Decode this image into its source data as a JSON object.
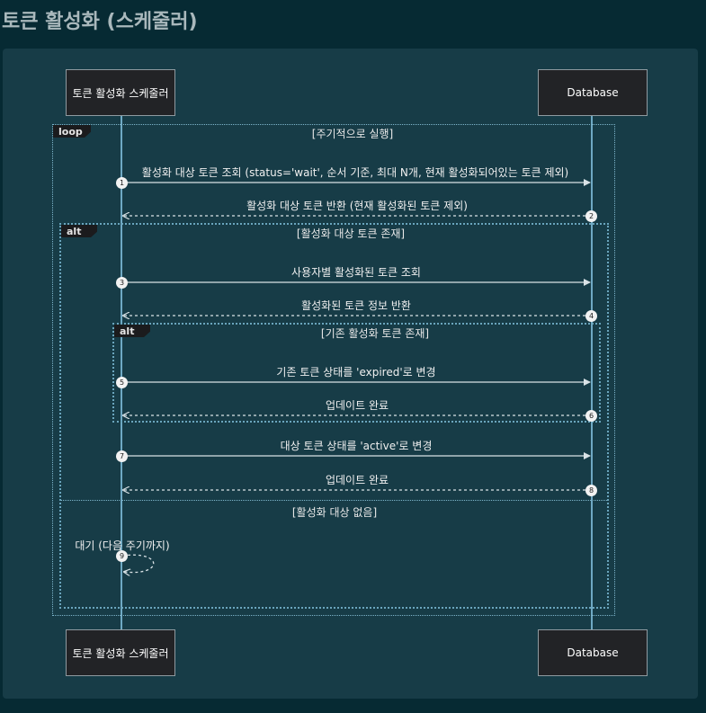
{
  "page": {
    "title": "토큰 활성화 (스케줄러)"
  },
  "actors": {
    "scheduler": "토큰 활성화 스케줄러",
    "database": "Database"
  },
  "frames": {
    "loop": {
      "tag": "loop",
      "condition": "[주기적으로 실행]"
    },
    "alt_outer": {
      "tag": "alt",
      "condition": "[활성화 대상 토큰 존재]",
      "else_condition": "[활성화 대상 없음]"
    },
    "alt_inner": {
      "tag": "alt",
      "condition": "[기존 활성화 토큰 존재]"
    }
  },
  "messages": [
    {
      "n": "1",
      "text": "활성화 대상 토큰 조회 (status='wait', 순서 기준, 최대 N개, 현재 활성화되어있는 토큰 제외)"
    },
    {
      "n": "2",
      "text": "활성화 대상 토큰 반환 (현재 활성화된 토큰 제외)"
    },
    {
      "n": "3",
      "text": "사용자별 활성화된 토큰 조회"
    },
    {
      "n": "4",
      "text": "활성화된 토큰 정보 반환"
    },
    {
      "n": "5",
      "text": "기존 토큰 상태를 'expired'로 변경"
    },
    {
      "n": "6",
      "text": "업데이트 완료"
    },
    {
      "n": "7",
      "text": "대상 토큰 상태를 'active'로 변경"
    },
    {
      "n": "8",
      "text": "업데이트 완료"
    },
    {
      "n": "9",
      "text": "대기 (다음 주기까지)"
    }
  ],
  "colors": {
    "background": "#062a33",
    "panel": "#173c47",
    "lifeline": "#6fa9c4",
    "arrow": "#d9e2e6",
    "actor_box": "#222326"
  }
}
